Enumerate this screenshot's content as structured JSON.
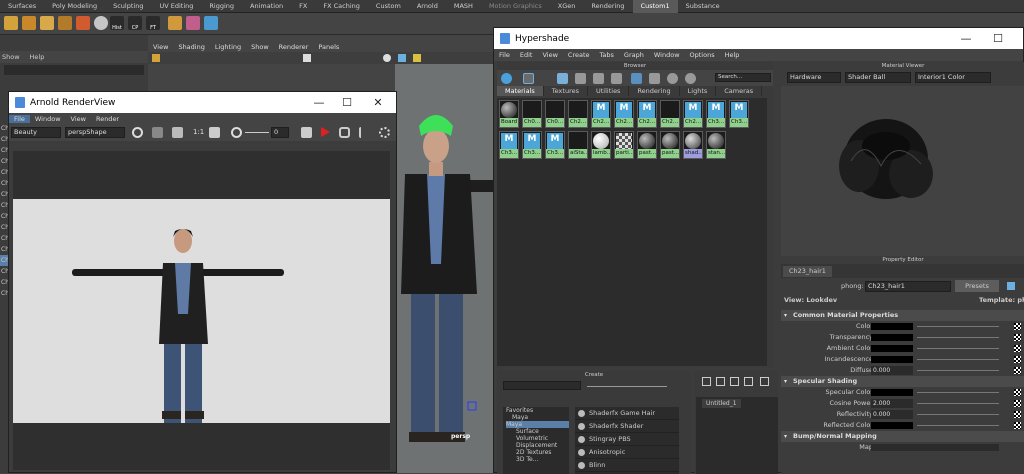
{
  "shelf_tabs": [
    "Surfaces",
    "Poly Modeling",
    "Sculpting",
    "UV Editing",
    "Rigging",
    "Animation",
    "FX",
    "FX Caching",
    "Custom",
    "Arnold",
    "MASH",
    "Motion Graphics",
    "XGen",
    "Rendering",
    "Custom1",
    "Substance"
  ],
  "shelf_icon_labels": {
    "hist": "Hist",
    "cp": "CP",
    "ft": "FT"
  },
  "left_panel": {
    "show": "Show",
    "help": "Help",
    "items": [
      "Ch",
      "Ch",
      "Ch",
      "Ch",
      "Ch",
      "Ch",
      "Ch",
      "Ch",
      "Ch",
      "Ch",
      "Ch",
      "Ch",
      "Ch",
      "Ch",
      "Ch",
      "Ch"
    ]
  },
  "viewport": {
    "menu": [
      "View",
      "Shading",
      "Lighting",
      "Show",
      "Renderer",
      "Panels"
    ],
    "camera": "persp"
  },
  "arnold": {
    "title": "Arnold RenderView",
    "menu": [
      "File",
      "Window",
      "View",
      "Render"
    ],
    "aov": "Beauty",
    "camera": "perspShape",
    "ratio": "1:1",
    "exposure": "0"
  },
  "hypershade": {
    "title": "Hypershade",
    "menu": [
      "File",
      "Edit",
      "View",
      "Create",
      "Tabs",
      "Graph",
      "Window",
      "Options",
      "Help"
    ],
    "browser_label": "Browser",
    "search_placeholder": "Search...",
    "tabs": [
      "Materials",
      "Textures",
      "Utilities",
      "Rendering",
      "Lights",
      "Cameras"
    ],
    "row1": [
      "Board",
      "Ch0...",
      "Ch0...",
      "Ch2...",
      "Ch2...",
      "Ch2...",
      "Ch2...",
      "Ch2...",
      "Ch2...",
      "Ch3...",
      "Ch3..."
    ],
    "row2": [
      "Ch3...",
      "Ch3...",
      "Ch3...",
      "aiSta...",
      "lamb...",
      "parti...",
      "past...",
      "past...",
      "shad...",
      "stan..."
    ],
    "create_label": "Create",
    "create_tree": [
      "Favorites",
      "Maya",
      "Maya",
      "Surface",
      "Volumetric",
      "Displacement",
      "2D Textures",
      "3D Te..."
    ],
    "create_list": [
      "Shaderfx Game Hair",
      "Shaderfx Shader",
      "Stingray PBS",
      "Anisotropic",
      "Blinn"
    ],
    "untitled_tab": "Untitled_1",
    "material_viewer": {
      "label": "Material Viewer",
      "renderer": "Hardware",
      "geometry": "Shader Ball",
      "env": "Interior1 Color"
    },
    "property_editor": {
      "label": "Property Editor",
      "node_tab": "Ch23_hair1",
      "type_label": "phong:",
      "node_name": "Ch23_hair1",
      "presets": "Presets",
      "view": "View: Lookdev",
      "template": "Template: phon",
      "sections": {
        "common": "Common Material Properties",
        "specular": "Specular Shading",
        "bump": "Bump/Normal Mapping"
      },
      "common_rows": [
        "Color",
        "Transparency",
        "Ambient Color",
        "Incandescence",
        "Diffuse"
      ],
      "diffuse_value": "0.000",
      "specular_rows": [
        "Specular Color",
        "Cosine Power",
        "Reflectivity",
        "Reflected Color"
      ],
      "cosine_value": "2.000",
      "reflectivity_value": "0.000",
      "bump_row": "Map"
    }
  },
  "colors": {
    "accent": "#5aa0d8",
    "swatch_green": "#8fd18c",
    "maya_bg": "#444444"
  }
}
